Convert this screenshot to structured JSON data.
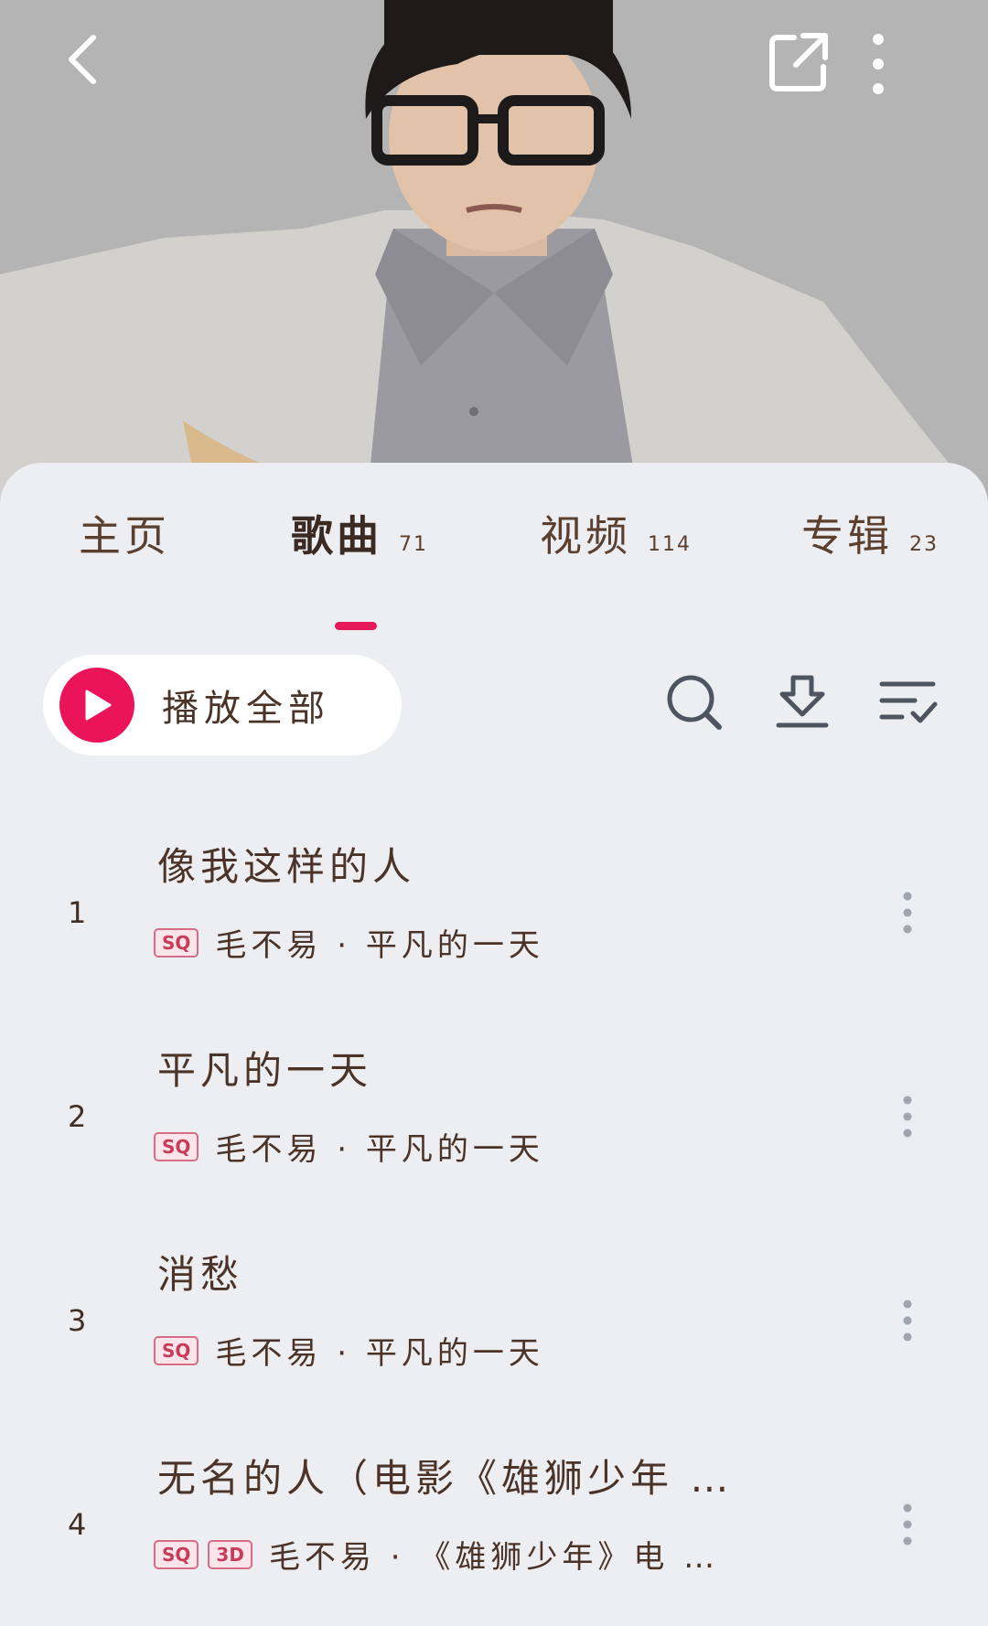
{
  "header": {
    "back_icon": "chevron-left-icon",
    "share_icon": "share-icon",
    "more_icon": "more-vertical-icon"
  },
  "tabs": [
    {
      "label": "主页",
      "count": ""
    },
    {
      "label": "歌曲",
      "count": "71"
    },
    {
      "label": "视频",
      "count": "114"
    },
    {
      "label": "专辑",
      "count": "23"
    }
  ],
  "actions": {
    "play_all_label": "播放全部",
    "accent_color": "#ec1458"
  },
  "songs": [
    {
      "index": "1",
      "title": "像我这样的人",
      "badges": [
        "SQ"
      ],
      "meta": "毛不易 · 平凡的一天"
    },
    {
      "index": "2",
      "title": "平凡的一天",
      "badges": [
        "SQ"
      ],
      "meta": "毛不易 · 平凡的一天"
    },
    {
      "index": "3",
      "title": "消愁",
      "badges": [
        "SQ"
      ],
      "meta": "毛不易 · 平凡的一天"
    },
    {
      "index": "4",
      "title": "无名的人（电影《雄狮少年 …",
      "badges": [
        "SQ",
        "3D"
      ],
      "meta": "毛不易 · 《雄狮少年》电 …"
    }
  ]
}
